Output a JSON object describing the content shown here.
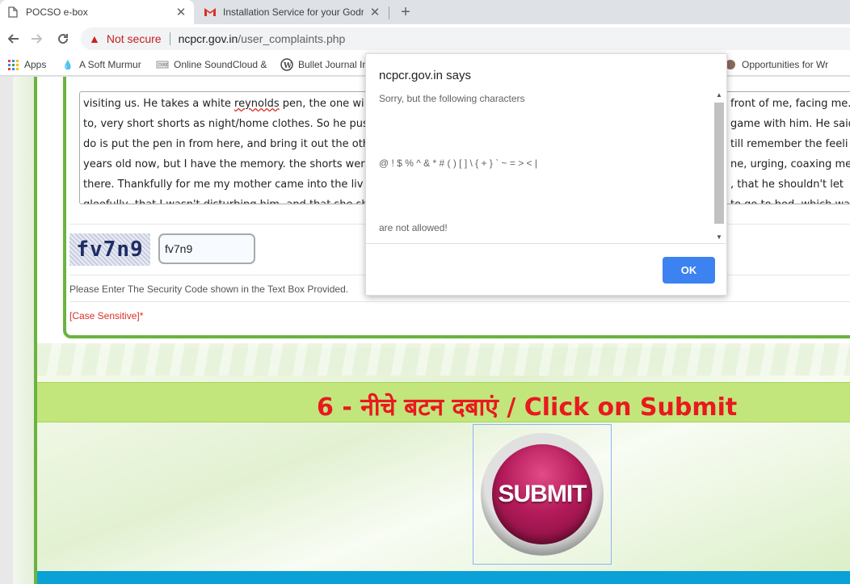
{
  "browser": {
    "tabs": [
      {
        "title": "POCSO e-box",
        "icon": "page-icon"
      },
      {
        "title": "Installation Service for your Godr",
        "icon": "gmail-icon"
      }
    ],
    "new_tab_label": "+",
    "address": {
      "warning": "Not secure",
      "domain": "ncpcr.gov.in",
      "path": "/user_complaints.php"
    },
    "bookmarks": [
      {
        "label": "Apps",
        "icon": "apps-grid-icon"
      },
      {
        "label": "A Soft Murmur",
        "icon": "drop-icon"
      },
      {
        "label": "Online SoundCloud &",
        "icon": "soundcloud-icon"
      },
      {
        "label": "Bullet Journal In",
        "icon": "wordpress-icon"
      },
      {
        "label": "Opportunities for Wr",
        "icon": "bookmark-site-icon"
      }
    ]
  },
  "form": {
    "textarea_lines": [
      "visiting us. He takes a white reynolds pen, the one wi",
      "to, very short shorts as night/home clothes. So he pus",
      "do is put the pen in from here, and bring it out the oth",
      "years old now, but I have the memory. the shorts wer",
      "there. Thankfully for me my mother came  into the liv",
      "gleefully, that I wasn't disturbing him, and that she sh"
    ],
    "textarea_lines_right": [
      "front of me, facing me.",
      "game with him. He said",
      "till remember the feeli",
      "ne, urging, coaxing me",
      ", that he shouldn't let",
      "to go to bed, which wa"
    ],
    "spellcheck_word": "reynolds",
    "captcha_text": "fv7n9",
    "captcha_input_value": "fv7n9",
    "help_text": "Please Enter The Security Code shown in the Text Box Provided.",
    "case_sensitive": "[Case Sensitive]*"
  },
  "step6": {
    "label": "6 - नीचे बटन दबाएं / Click on Submit"
  },
  "submit_button_label": "SUBMIT",
  "dialog": {
    "origin": "ncpcr.gov.in says",
    "line1": "Sorry, but the following characters",
    "chars": "@ ! $ % ^ & * # ( ) [ ] \\ { + } ` ~ = > < |",
    "line3": "are not allowed!",
    "ok_label": "OK"
  },
  "colors": {
    "accent_green": "#6bb33f",
    "step_band": "#c2e67c",
    "step_text": "#e8191f",
    "submit": "#b41b5a",
    "dialog_ok": "#1a73e8",
    "not_secure": "#c5221f"
  }
}
